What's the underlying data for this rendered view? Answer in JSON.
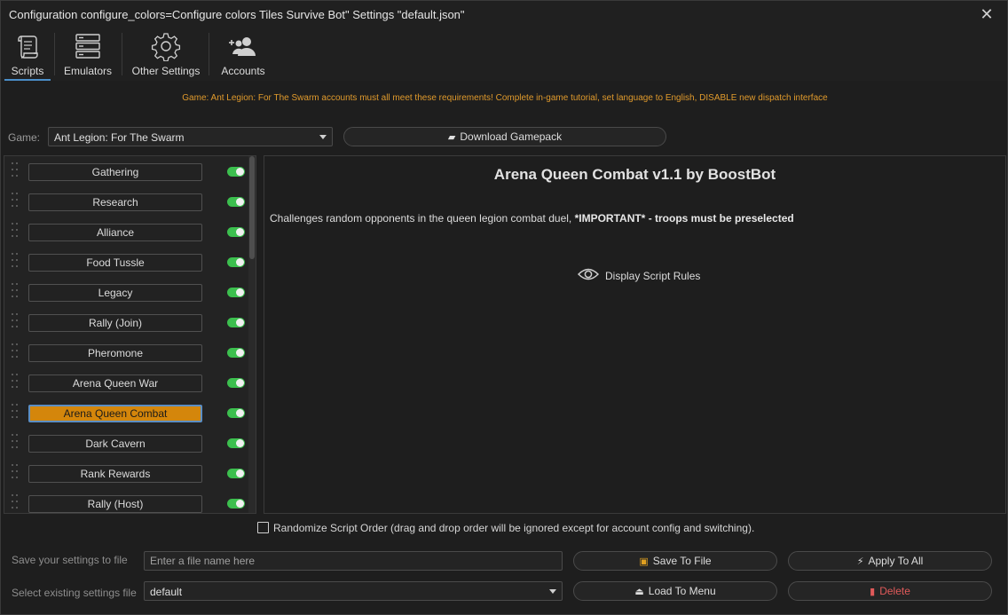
{
  "window": {
    "title": "Configuration configure_colors=Configure colors Tiles Survive Bot\" Settings \"default.json\"",
    "close_glyph": "✕"
  },
  "tabs": [
    {
      "label": "Scripts",
      "icon": "scroll-icon",
      "active": true
    },
    {
      "label": "Emulators",
      "icon": "server-icon",
      "active": false
    },
    {
      "label": "Other Settings",
      "icon": "gear-icon",
      "active": false
    },
    {
      "label": "Accounts",
      "icon": "users-add-icon",
      "active": false
    }
  ],
  "warning_text": "Game: Ant Legion: For The Swarm accounts must all meet these requirements! Complete in-game tutorial, set language to English, DISABLE new dispatch interface",
  "game": {
    "label": "Game:",
    "selected": "Ant Legion: For The Swarm",
    "download_label": "Download Gamepack"
  },
  "scripts": [
    {
      "label": "Gathering",
      "enabled": true,
      "selected": false
    },
    {
      "label": "Research",
      "enabled": true,
      "selected": false
    },
    {
      "label": "Alliance",
      "enabled": true,
      "selected": false
    },
    {
      "label": "Food Tussle",
      "enabled": true,
      "selected": false
    },
    {
      "label": "Legacy",
      "enabled": true,
      "selected": false
    },
    {
      "label": "Rally (Join)",
      "enabled": true,
      "selected": false
    },
    {
      "label": "Pheromone",
      "enabled": true,
      "selected": false
    },
    {
      "label": "Arena Queen War",
      "enabled": true,
      "selected": false
    },
    {
      "label": "Arena Queen Combat",
      "enabled": true,
      "selected": true
    },
    {
      "label": "Dark Cavern",
      "enabled": true,
      "selected": false
    },
    {
      "label": "Rank Rewards",
      "enabled": true,
      "selected": false
    },
    {
      "label": "Rally (Host)",
      "enabled": true,
      "selected": false
    }
  ],
  "detail": {
    "title": "Arena Queen Combat v1.1 by BoostBot",
    "description_plain": "Challenges random opponents in the queen legion combat duel, ",
    "description_bold": "*IMPORTANT* - troops must be preselected",
    "rules_label": "Display Script Rules"
  },
  "randomize": {
    "label": "Randomize Script Order (drag and drop order will be ignored except for account config and switching).",
    "checked": false
  },
  "save_row": {
    "label": "Save your settings to file",
    "placeholder": "Enter a file name here",
    "value": "",
    "save_label": "Save To File",
    "apply_label": "Apply To All"
  },
  "load_row": {
    "label": "Select existing settings file",
    "selected": "default",
    "load_label": "Load To Menu",
    "delete_label": "Delete"
  },
  "colors": {
    "accent": "#4a8ec8",
    "warning": "#e09a2c",
    "selected_script": "#d4860b",
    "toggle_on": "#3cbf4e",
    "danger": "#e05a5a"
  }
}
